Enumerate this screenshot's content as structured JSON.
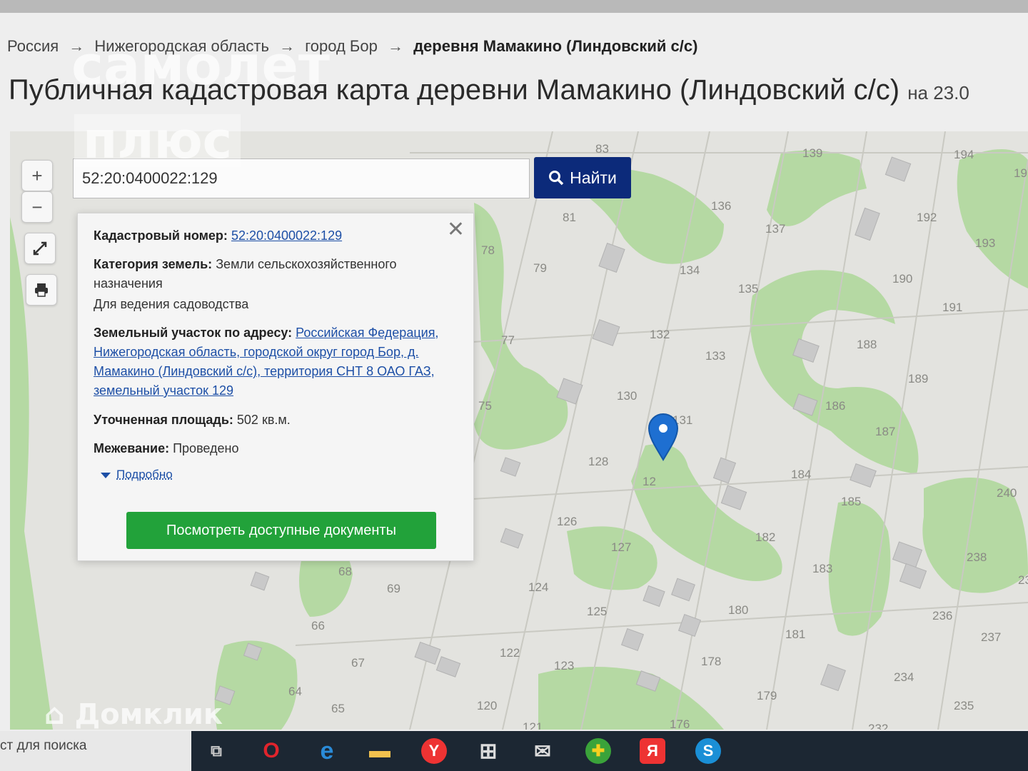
{
  "breadcrumb": {
    "items": [
      "Россия",
      "Нижегородская область",
      "город Бор"
    ],
    "separator": "→",
    "current": "деревня Мамакино (Линдовский с/с)"
  },
  "page": {
    "title": "Публичная кадастровая карта деревни Мамакино (Линдовский с/с)",
    "date_prefix": "на 23.0"
  },
  "map_controls": {
    "zoom_in": "+",
    "zoom_out": "−",
    "fullscreen_icon": "expand-icon",
    "print_icon": "print-icon"
  },
  "search": {
    "value": "52:20:0400022:129",
    "button_label": "Найти",
    "button_icon": "search-icon"
  },
  "popup": {
    "cadastral_label": "Кадастровый номер:",
    "cadastral_value": "52:20:0400022:129",
    "category_label": "Категория земель:",
    "category_value": "Земли сельскохозяйственного назначения",
    "usage": "Для ведения садоводства",
    "address_label": "Земельный участок по адресу:",
    "address_value": "Российская Федерация, Нижегородская область, городской округ город Бор, д. Мамакино (Линдовский с/с), территория СНТ 8 ОАО ГАЗ, земельный участок 129",
    "area_label": "Уточненная площадь:",
    "area_value": "502 кв.м.",
    "survey_label": "Межевание:",
    "survey_value": "Проведено",
    "more_label": "Подробно",
    "docs_button": "Посмотреть доступные документы"
  },
  "map_labels": [
    "83",
    "139",
    "194",
    "19",
    "81",
    "136",
    "137",
    "192",
    "193",
    "78",
    "79",
    "134",
    "135",
    "190",
    "191",
    "77",
    "132",
    "133",
    "188",
    "189",
    "75",
    "130",
    "131",
    "186",
    "187",
    "128",
    "12",
    "184",
    "185",
    "240",
    "126",
    "127",
    "182",
    "183",
    "238",
    "23",
    "68",
    "69",
    "124",
    "125",
    "180",
    "181",
    "236",
    "237",
    "66",
    "122",
    "123",
    "178",
    "179",
    "234",
    "67",
    "64",
    "65",
    "120",
    "121",
    "176",
    "235",
    "232"
  ],
  "watermarks": {
    "samolet_1": "самолет",
    "samolet_2": "плюс",
    "domclick": "Домклик"
  },
  "taskbar": {
    "search_text": "ст для поиска",
    "apps": [
      "task-view",
      "opera",
      "edge",
      "explorer",
      "yandex-browser",
      "store",
      "mail",
      "green-app",
      "yandex",
      "skype"
    ],
    "app_glyphs": [
      "⧉",
      "O",
      "e",
      "▬",
      "Y",
      "⊞",
      "✉",
      "✚",
      "Я",
      "S"
    ]
  },
  "colors": {
    "search_button": "#0c2a7a",
    "docs_button": "#22a23a",
    "link": "#1d4fa6",
    "marker": "#1e6fd1",
    "green_area": "#b5d9a3"
  }
}
